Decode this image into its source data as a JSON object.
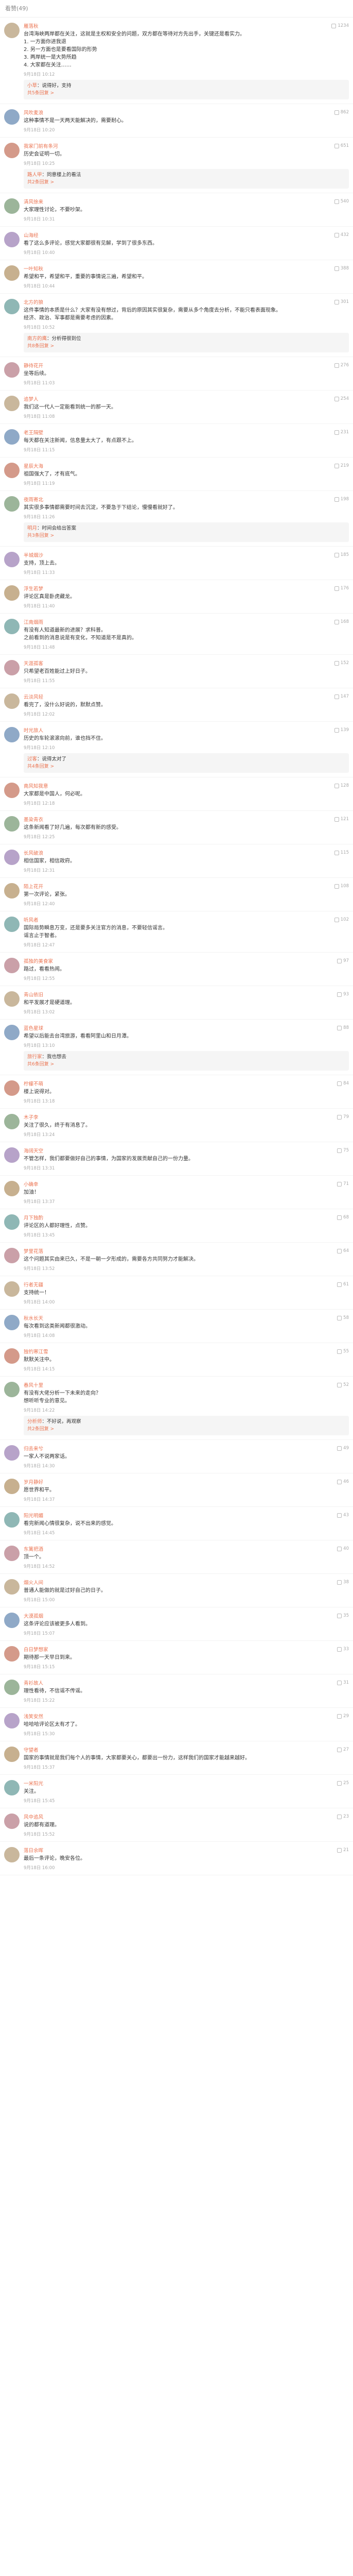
{
  "header": {
    "title": "看赞(49)"
  },
  "colors": {
    "username": "#eb7350",
    "meta": "#aaaaaa",
    "divider": "#f3f3f3"
  },
  "comments": [
    {
      "user": "雁落秋",
      "likes": "1234",
      "text": "台湾海峡两岸都在关注，这就是主权和安全的问题，双方都在等待对方先出手，关键还是看实力。\n1. 一方面你进我退\n2. 另一方面也是要看国际的形势\n3. 两岸统一是大势所趋\n4. 大家都在关注……",
      "time": "9月18日 10:12",
      "reply": {
        "user": "小草",
        "text": "说得好，支持",
        "more": "共5条回复 >"
      }
    },
    {
      "user": "风吹麦浪",
      "likes": "862",
      "text": "这种事情不是一天两天能解决的，需要耐心。",
      "time": "9月18日 10:20"
    },
    {
      "user": "我家门前有条河",
      "likes": "651",
      "text": "历史会证明一切。",
      "time": "9月18日 10:25",
      "reply": {
        "user": "路人甲",
        "text": "同意楼上的看法",
        "more": "共2条回复 >"
      }
    },
    {
      "user": "清风徐来",
      "likes": "540",
      "text": "大家理性讨论，不要吵架。",
      "time": "9月18日 10:31"
    },
    {
      "user": "山海经",
      "likes": "432",
      "text": "看了这么多评论，感觉大家都很有见解，学到了很多东西。",
      "time": "9月18日 10:40"
    },
    {
      "user": "一叶知秋",
      "likes": "388",
      "text": "希望和平，希望和平，重要的事情说三遍，希望和平。",
      "time": "9月18日 10:44"
    },
    {
      "user": "北方的狼",
      "likes": "301",
      "text": "这件事情的本质是什么？大家有没有想过，背后的原因其实很复杂，需要从多个角度去分析，不能只看表面现象。\n经济、政治、军事都是需要考虑的因素。",
      "time": "9月18日 10:52",
      "reply": {
        "user": "南方的鹰",
        "text": "分析得很到位",
        "more": "共8条回复 >"
      }
    },
    {
      "user": "静待花开",
      "likes": "276",
      "text": "坐等后续。",
      "time": "9月18日 11:03"
    },
    {
      "user": "追梦人",
      "likes": "254",
      "text": "我们这一代人一定能看到统一的那一天。",
      "time": "9月18日 11:08"
    },
    {
      "user": "老王隔壁",
      "likes": "231",
      "text": "每天都在关注新闻，信息量太大了，有点跟不上。",
      "time": "9月18日 11:15"
    },
    {
      "user": "星辰大海",
      "likes": "219",
      "text": "祖国强大了，才有底气。",
      "time": "9月18日 11:19"
    },
    {
      "user": "夜雨寄北",
      "likes": "198",
      "text": "其实很多事情都需要时间去沉淀，不要急于下结论，慢慢看就好了。",
      "time": "9月18日 11:26",
      "reply": {
        "user": "明月",
        "text": "时间会给出答案",
        "more": "共3条回复 >"
      }
    },
    {
      "user": "半城烟沙",
      "likes": "185",
      "text": "支持，顶上去。",
      "time": "9月18日 11:33"
    },
    {
      "user": "浮生若梦",
      "likes": "176",
      "text": "评论区真是卧虎藏龙。",
      "time": "9月18日 11:40"
    },
    {
      "user": "江南烟雨",
      "likes": "168",
      "text": "有没有人知道最新的进展？求科普。\n之前看到的消息说是有变化，不知道是不是真的。",
      "time": "9月18日 11:48"
    },
    {
      "user": "天涯孤客",
      "likes": "152",
      "text": "只希望老百姓能过上好日子。",
      "time": "9月18日 11:55"
    },
    {
      "user": "云淡风轻",
      "likes": "147",
      "text": "看完了，没什么好说的，默默点赞。",
      "time": "9月18日 12:02"
    },
    {
      "user": "时光旅人",
      "likes": "139",
      "text": "历史的车轮滚滚向前，谁也挡不住。",
      "time": "9月18日 12:10",
      "reply": {
        "user": "过客",
        "text": "说得太对了",
        "more": "共4条回复 >"
      }
    },
    {
      "user": "南风知我意",
      "likes": "128",
      "text": "大家都是中国人，何必呢。",
      "time": "9月18日 12:18"
    },
    {
      "user": "墨染青衣",
      "likes": "121",
      "text": "这条新闻看了好几遍，每次都有新的感受。",
      "time": "9月18日 12:25"
    },
    {
      "user": "长风破浪",
      "likes": "115",
      "text": "相信国家，相信政府。",
      "time": "9月18日 12:31"
    },
    {
      "user": "陌上花开",
      "likes": "108",
      "text": "第一次评论，紧张。",
      "time": "9月18日 12:40"
    },
    {
      "user": "听风者",
      "likes": "102",
      "text": "国际局势瞬息万变，还是要多关注官方的消息，不要轻信谣言。\n谣言止于智者。",
      "time": "9月18日 12:47"
    },
    {
      "user": "孤独的美食家",
      "likes": "97",
      "text": "路过，看看热闹。",
      "time": "9月18日 12:55"
    },
    {
      "user": "青山依旧",
      "likes": "93",
      "text": "和平发展才是硬道理。",
      "time": "9月18日 13:02"
    },
    {
      "user": "蓝色星球",
      "likes": "88",
      "text": "希望以后能去台湾旅游，看看阿里山和日月潭。",
      "time": "9月18日 13:10",
      "reply": {
        "user": "旅行家",
        "text": "我也想去",
        "more": "共6条回复 >"
      }
    },
    {
      "user": "柠檬不萌",
      "likes": "84",
      "text": "楼上说得对。",
      "time": "9月18日 13:18"
    },
    {
      "user": "木子李",
      "likes": "79",
      "text": "关注了很久，终于有消息了。",
      "time": "9月18日 13:24"
    },
    {
      "user": "海阔天空",
      "likes": "75",
      "text": "不管怎样，我们都要做好自己的事情，为国家的发展贡献自己的一份力量。",
      "time": "9月18日 13:31"
    },
    {
      "user": "小确幸",
      "likes": "71",
      "text": "加油！",
      "time": "9月18日 13:37"
    },
    {
      "user": "月下独酌",
      "likes": "68",
      "text": "评论区的人都好理性，点赞。",
      "time": "9月18日 13:45"
    },
    {
      "user": "梦里花落",
      "likes": "64",
      "text": "这个问题其实由来已久，不是一朝一夕形成的，需要各方共同努力才能解决。",
      "time": "9月18日 13:52"
    },
    {
      "user": "行者无疆",
      "likes": "61",
      "text": "支持统一！",
      "time": "9月18日 14:00"
    },
    {
      "user": "秋水长天",
      "likes": "58",
      "text": "每次看到这类新闻都很激动。",
      "time": "9月18日 14:08"
    },
    {
      "user": "独钓寒江雪",
      "likes": "55",
      "text": "默默关注中。",
      "time": "9月18日 14:15"
    },
    {
      "user": "春风十里",
      "likes": "52",
      "text": "有没有大佬分析一下未来的走向？\n想听听专业的意见。",
      "time": "9月18日 14:22",
      "reply": {
        "user": "分析师",
        "text": "不好说，再观察",
        "more": "共2条回复 >"
      }
    },
    {
      "user": "归去来兮",
      "likes": "49",
      "text": "一家人不说两家话。",
      "time": "9月18日 14:30"
    },
    {
      "user": "岁月静好",
      "likes": "46",
      "text": "愿世界和平。",
      "time": "9月18日 14:37"
    },
    {
      "user": "阳光明媚",
      "likes": "43",
      "text": "看完新闻心情很复杂，说不出来的感觉。",
      "time": "9月18日 14:45"
    },
    {
      "user": "东篱把酒",
      "likes": "40",
      "text": "顶一个。",
      "time": "9月18日 14:52"
    },
    {
      "user": "烟火人间",
      "likes": "38",
      "text": "普通人能做的就是过好自己的日子。",
      "time": "9月18日 15:00"
    },
    {
      "user": "大漠孤烟",
      "likes": "35",
      "text": "这条评论应该被更多人看到。",
      "time": "9月18日 15:07"
    },
    {
      "user": "白日梦想家",
      "likes": "33",
      "text": "期待那一天早日到来。",
      "time": "9月18日 15:15"
    },
    {
      "user": "青衫故人",
      "likes": "31",
      "text": "理性看待，不信谣不传谣。",
      "time": "9月18日 15:22"
    },
    {
      "user": "浅笑安然",
      "likes": "29",
      "text": "哈哈哈评论区太有才了。",
      "time": "9月18日 15:30"
    },
    {
      "user": "守望者",
      "likes": "27",
      "text": "国家的事情就是我们每个人的事情，大家都要关心，都要出一份力，这样我们的国家才能越来越好。",
      "time": "9月18日 15:37"
    },
    {
      "user": "一米阳光",
      "likes": "25",
      "text": "关注。",
      "time": "9月18日 15:45"
    },
    {
      "user": "风中追风",
      "likes": "23",
      "text": "说的都有道理。",
      "time": "9月18日 15:52"
    },
    {
      "user": "落日余晖",
      "likes": "21",
      "text": "最后一条评论，晚安各位。",
      "time": "9月18日 16:00"
    }
  ]
}
